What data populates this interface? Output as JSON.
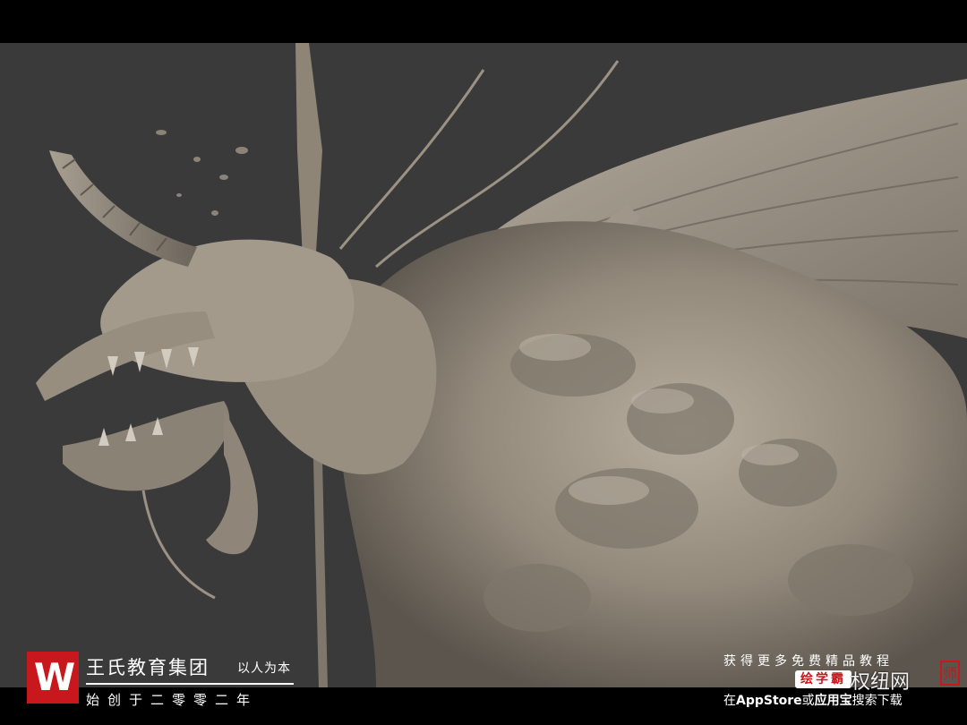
{
  "brand": {
    "logo_letter": "W",
    "name": "王氏教育集团",
    "slogan": "以人为本",
    "founded": "始创于二零零二年"
  },
  "promo": {
    "top_line": "获得更多免费精品教程",
    "badge": "绘学霸",
    "watermark": "权纽网",
    "bottom_prefix": "在",
    "bottom_store": "AppStore",
    "bottom_mid": "或",
    "bottom_app": "应用宝",
    "bottom_suffix": "搜索下载",
    "seal_char": "师"
  },
  "colors": {
    "brand_red": "#c8171d",
    "background": "#3a3a3b",
    "clay": "#9c9283",
    "letterbox": "#000000"
  }
}
